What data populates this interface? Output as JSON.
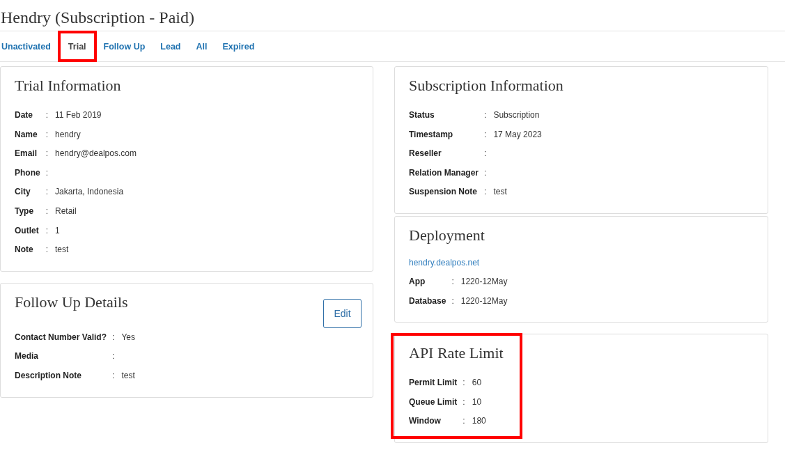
{
  "page": {
    "title": "Hendry (Subscription - Paid)"
  },
  "tabs": [
    {
      "label": "Unactivated",
      "selected": false,
      "highlighted": false
    },
    {
      "label": "Trial",
      "selected": true,
      "highlighted": true
    },
    {
      "label": "Follow Up",
      "selected": false,
      "highlighted": false
    },
    {
      "label": "Lead",
      "selected": false,
      "highlighted": false
    },
    {
      "label": "All",
      "selected": false,
      "highlighted": false
    },
    {
      "label": "Expired",
      "selected": false,
      "highlighted": false
    }
  ],
  "columns": [
    {
      "cards": [
        {
          "title": "Trial Information",
          "highlighted": false,
          "rows": [
            {
              "label": "Date",
              "sep": ":",
              "value": "11 Feb 2019"
            },
            {
              "label": "Name",
              "sep": ":",
              "value": "hendry"
            },
            {
              "label": "Email",
              "sep": ":",
              "value": "hendry@dealpos.com"
            },
            {
              "label": "Phone",
              "sep": ":"
            },
            {
              "label": "City",
              "sep": ":",
              "value": "Jakarta, Indonesia"
            },
            {
              "label": "Type",
              "sep": ":",
              "value": "Retail"
            },
            {
              "label": "Outlet",
              "sep": ":",
              "value": "1"
            },
            {
              "label": "Note",
              "sep": ":",
              "value": "test"
            }
          ]
        },
        {
          "title": "Follow Up Details",
          "highlighted": false,
          "button": "Edit",
          "rows": [
            {
              "label": "Contact Number Valid?",
              "sep": ":",
              "value": "Yes"
            },
            {
              "label": "Media",
              "sep": ":"
            },
            {
              "label": "Description Note",
              "sep": ":",
              "value": "test"
            }
          ]
        }
      ]
    },
    {
      "cards": [
        {
          "title": "Subscription Information",
          "highlighted": false,
          "rows": [
            {
              "label": "Status",
              "sep": ":",
              "value": "Subscription"
            },
            {
              "label": "Timestamp",
              "sep": ":",
              "value": "17 May 2023"
            },
            {
              "label": "Reseller",
              "sep": ":"
            },
            {
              "label": "Relation Manager",
              "sep": ":"
            },
            {
              "label": "Suspension Note",
              "sep": ":",
              "value": "test"
            }
          ]
        },
        {
          "title": "Deployment",
          "highlighted": false,
          "link": "hendry.dealpos.net",
          "rows": [
            {
              "label": "App",
              "sep": ":",
              "value": "1220-12May"
            },
            {
              "label": "Database",
              "sep": ":",
              "value": "1220-12May"
            }
          ]
        },
        {
          "title": "API Rate Limit",
          "highlighted": true,
          "rows": [
            {
              "label": "Permit Limit",
              "sep": ":",
              "value": "60"
            },
            {
              "label": "Queue Limit",
              "sep": ":",
              "value": "10"
            },
            {
              "label": "Window",
              "sep": ":",
              "value": "180"
            }
          ]
        }
      ]
    }
  ]
}
